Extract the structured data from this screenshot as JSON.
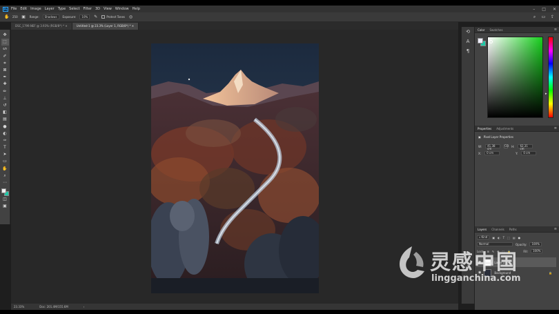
{
  "app": {
    "logo_text": "Ps",
    "menu": [
      "File",
      "Edit",
      "Image",
      "Layer",
      "Type",
      "Select",
      "Filter",
      "3D",
      "View",
      "Window",
      "Help"
    ]
  },
  "options_bar": {
    "brush_size": "250",
    "range_label": "Range:",
    "range_value": "Shadows",
    "exposure_label": "Exposure:",
    "exposure_value": "10%",
    "protect_tones_label": "Protect Tones"
  },
  "tabs": [
    {
      "label": "DSC_1799.NEF @ 3.93% (RGB/8*) *",
      "active": false
    },
    {
      "label": "Untitled-1 @ 23.3% (Layer 1, RGB/8*) *",
      "active": true
    }
  ],
  "status": {
    "zoom": "23.33%",
    "doc": "Doc: 201.4M/155.6M"
  },
  "panels": {
    "color_tabs": [
      "Color",
      "Swatches"
    ],
    "properties_tabs": [
      "Properties",
      "Adjustments"
    ],
    "properties_title": "Pixel Layer Properties",
    "w_label": "W:",
    "w_value": "41,38 cm",
    "h_label": "H:",
    "h_value": "62,31 cm",
    "x_label": "X:",
    "x_value": "0 cm",
    "y_label": "Y:",
    "y_value": "0 cm",
    "link_label": "GO",
    "layers_tabs": [
      "Layers",
      "Channels",
      "Paths"
    ],
    "kind_label": "Kind",
    "blend_mode": "Normal",
    "opacity_label": "Opacity:",
    "opacity_value": "100%",
    "lock_label": "Lock:",
    "fill_label": "Fill:",
    "fill_value": "100%",
    "layers": [
      {
        "name": "Layer 1",
        "active": true
      },
      {
        "name": "Background",
        "active": false
      }
    ]
  },
  "watermark": {
    "cn": "灵感中国",
    "en": "lingganchina.com"
  },
  "colors": {
    "foreground": "#f0f0f0",
    "background": "#1fc9a8",
    "accent": "#31a8ff"
  }
}
